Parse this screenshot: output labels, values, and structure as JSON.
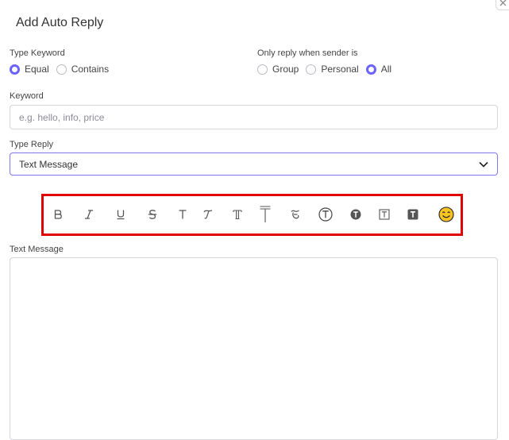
{
  "modal": {
    "title": "Add Auto Reply"
  },
  "type_keyword": {
    "label": "Type Keyword",
    "options": [
      "Equal",
      "Contains"
    ],
    "selected": "Equal"
  },
  "sender_filter": {
    "label": "Only reply when sender is",
    "options": [
      "Group",
      "Personal",
      "All"
    ],
    "selected": "All"
  },
  "keyword": {
    "label": "Keyword",
    "value": "",
    "placeholder": "e.g. hello, info, price"
  },
  "type_reply": {
    "label": "Type Reply",
    "selected": "Text Message"
  },
  "toolbar": {
    "buttons": [
      "bold",
      "italic",
      "underline",
      "strikethrough",
      "sans-serif",
      "script",
      "double-struck",
      "overline-t",
      "fraktur",
      "circled-t",
      "negative-circled-t",
      "squared-t",
      "negative-squared-t",
      "emoji"
    ]
  },
  "text_message": {
    "label": "Text Message",
    "value": ""
  },
  "colors": {
    "accent": "#6c63ff",
    "toolbar_highlight": "#e00000"
  }
}
